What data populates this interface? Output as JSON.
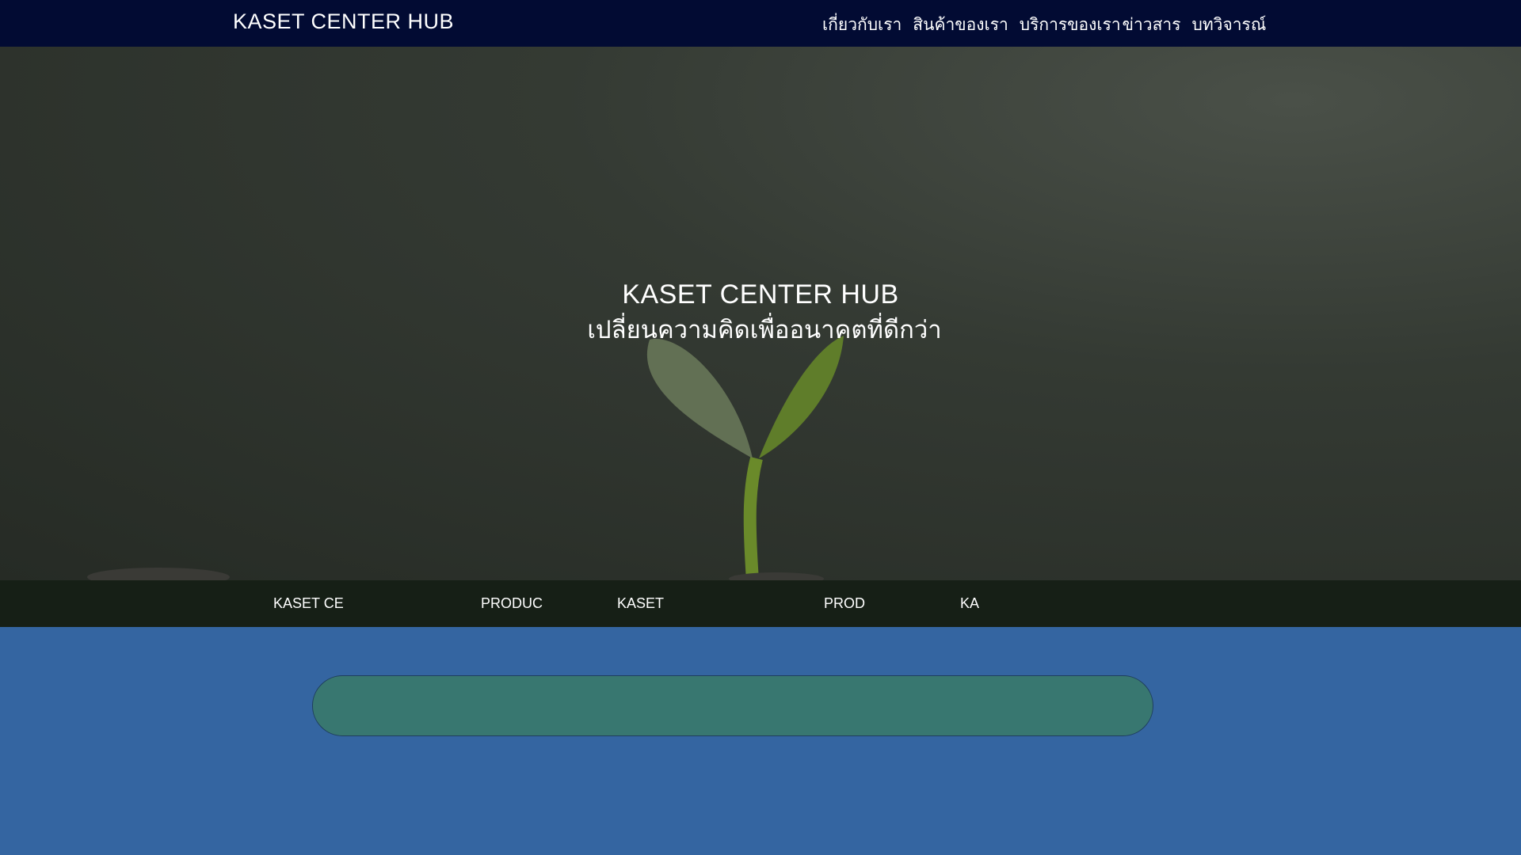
{
  "header": {
    "brand": "KASET CENTER HUB",
    "menu": [
      "เกี่ยวกับเรา",
      "สินค้าของเรา",
      "บริการของเรา",
      "ข่าวสาร",
      "บทวิจารณ์"
    ]
  },
  "hero": {
    "title": "KASET CENTER HUB",
    "subtitle": "เปลี่ยนความคิดเพื่ออนาคตที่ดีกว่า"
  },
  "subbar": {
    "items": [
      "KASET CE",
      "PRODUC",
      "KASET",
      "PROD",
      "KA"
    ]
  }
}
